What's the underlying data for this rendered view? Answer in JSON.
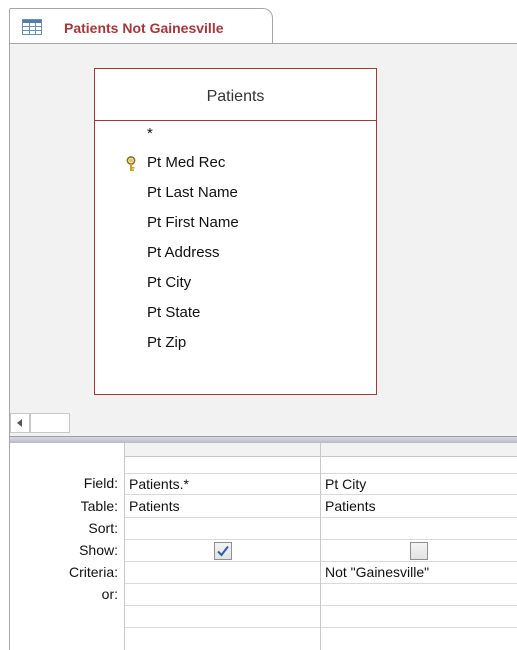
{
  "tab": {
    "label": "Patients Not Gainesville",
    "icon": "query-icon"
  },
  "table": {
    "title": "Patients",
    "fields": [
      {
        "label": "*",
        "key": false
      },
      {
        "label": "Pt Med Rec",
        "key": true
      },
      {
        "label": "Pt Last Name",
        "key": false
      },
      {
        "label": "Pt First Name",
        "key": false
      },
      {
        "label": "Pt Address",
        "key": false
      },
      {
        "label": "Pt City",
        "key": false
      },
      {
        "label": "Pt State",
        "key": false
      },
      {
        "label": "Pt Zip",
        "key": false
      }
    ]
  },
  "grid": {
    "row_labels": {
      "field": "Field:",
      "table": "Table:",
      "sort": "Sort:",
      "show": "Show:",
      "criteria": "Criteria:",
      "or": "or:"
    },
    "columns": [
      {
        "field": "Patients.*",
        "table": "Patients",
        "sort": "",
        "show": true,
        "criteria": "",
        "or": ""
      },
      {
        "field": "Pt City",
        "table": "Patients",
        "sort": "",
        "show": false,
        "criteria": "Not \"Gainesville\"",
        "or": ""
      }
    ]
  },
  "colors": {
    "accent": "#a4373a",
    "pane_bg": "#f2f2f2"
  }
}
